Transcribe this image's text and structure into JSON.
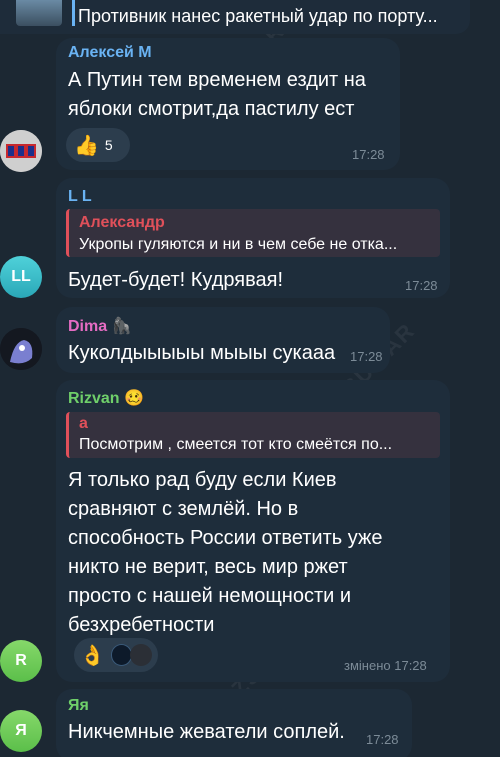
{
  "pinned": {
    "text": "Противник нанес ракетный удар по порту..."
  },
  "messages": [
    {
      "sender": "Алексей М",
      "sender_color": "#6ab3f3",
      "lines": [
        "А Путин тем временем ездит на",
        "яблоки смотрит,да пастилу ест"
      ],
      "reaction_emoji": "👍",
      "reaction_count": "5",
      "time": "17:28"
    },
    {
      "sender": "L L",
      "sender_color": "#6ab3f3",
      "avatar_text": "LL",
      "reply_name": "Александр",
      "reply_text": "Укропы гуляются и ни в чем себе не отка...",
      "lines": [
        "Будет-будет! Кудрявая!"
      ],
      "time": "17:28"
    },
    {
      "sender": "Dima",
      "sender_badge": "🦍",
      "sender_color": "#e56cc3",
      "lines": [
        "Куколдыыыыы мыыы сукааа"
      ],
      "time": "17:28"
    },
    {
      "sender": "Rizvan",
      "sender_badge": "🥴",
      "sender_color": "#6fcf6a",
      "reply_name": "a",
      "reply_text": "Посмотрим , смеется тот кто смеётся по...",
      "lines": [
        "Я только рад буду если Киев",
        "сравняют с землёй. Но в",
        "способность России ответить уже",
        "никто не верит, весь мир ржет",
        "просто с нашей немощности и",
        "безхребетности"
      ],
      "reaction_emoji": "👌",
      "edited_label": "змінено",
      "time": "17:28",
      "avatar_text": "R"
    },
    {
      "sender": "Яя",
      "sender_color": "#6fcf6a",
      "avatar_text": "Я",
      "lines": [
        "Никчемные жеватели соплей."
      ],
      "time": "17:28"
    }
  ],
  "watermark": "@ZSUWAR",
  "colors": {
    "background": "#1c2833",
    "bubble": "#1e2d3b",
    "accent_blue": "#6ab3f3",
    "reply_red": "#e0505a",
    "green": "#6fcf6a",
    "pink": "#e56cc3"
  }
}
